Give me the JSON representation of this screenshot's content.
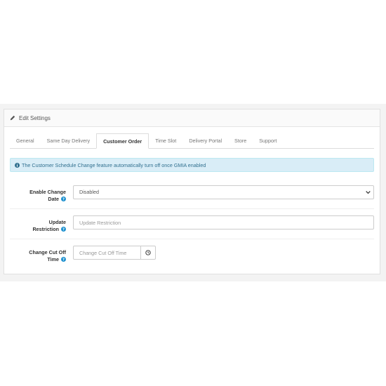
{
  "panel": {
    "title": "Edit Settings"
  },
  "tabs": [
    {
      "label": "General",
      "active": false
    },
    {
      "label": "Same Day Delivery",
      "active": false
    },
    {
      "label": "Customer Order",
      "active": true
    },
    {
      "label": "Time Slot",
      "active": false
    },
    {
      "label": "Delivery Portal",
      "active": false
    },
    {
      "label": "Store",
      "active": false
    },
    {
      "label": "Support",
      "active": false
    }
  ],
  "alert": {
    "text": "The Customer Schedule Change feature automatically turn off once GMIA enabled"
  },
  "form": {
    "enable_change_date": {
      "label_line1": "Enable Change",
      "label_line2": "Date",
      "value": "Disabled"
    },
    "update_restriction": {
      "label_line1": "Update",
      "label_line2": "Restriction",
      "placeholder": "Update Restriction"
    },
    "change_cut_off_time": {
      "label_line1": "Change Cut Off",
      "label_line2": "Time",
      "placeholder": "Change Cut Off Time"
    }
  },
  "colors": {
    "help_icon": "#1e91cf",
    "alert_bg": "#d9edf7",
    "alert_text": "#31708f"
  }
}
